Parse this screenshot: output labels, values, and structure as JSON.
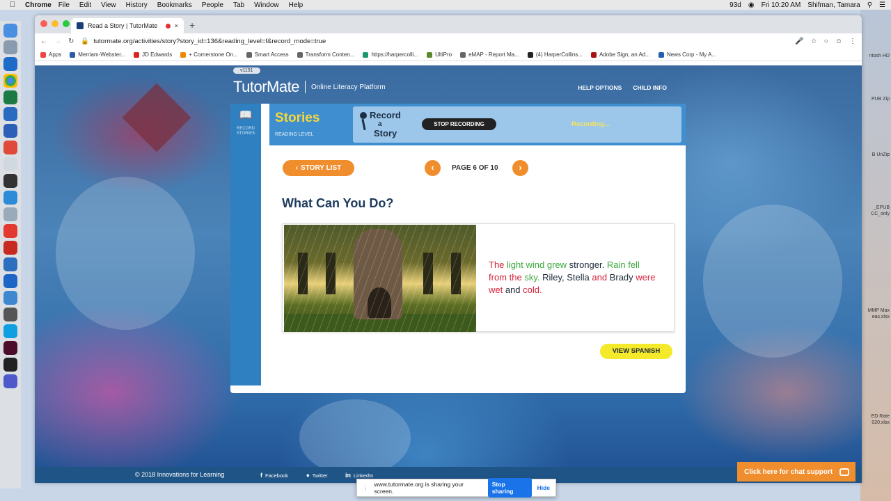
{
  "menubar": {
    "app": "Chrome",
    "items": [
      "File",
      "Edit",
      "View",
      "History",
      "Bookmarks",
      "People",
      "Tab",
      "Window",
      "Help"
    ],
    "battery": "93d",
    "clock": "Fri 10:20 AM",
    "user": "Shifman, Tamara"
  },
  "browser": {
    "tab_title": "Read a Story | TutorMate",
    "url": "tutormate.org/activities/story?story_id=136&reading_level=f&record_mode=true",
    "bookmarks": [
      "Apps",
      "Merriam-Webster...",
      "JD Edwards",
      "+ Cornerstone On...",
      "Smart Access",
      "Transform Conten...",
      "https://harpercolli...",
      "UltiPro",
      "eMAP - Report Ma...",
      "(4) HarperCollins...",
      "Adobe Sign, an Ad...",
      "News Corp - My A..."
    ]
  },
  "desktop_files": [
    "ntosh HD",
    "PUB Zip",
    "B UnZip",
    "_EPUB\nCC_only",
    "MMP Max\neas.xlsx",
    "ED Rate\n020.xlsx"
  ],
  "site": {
    "version": "v1191",
    "logo": "TutorMate",
    "tagline": "Online Literacy Platform",
    "nav": [
      "HELP OPTIONS",
      "CHILD INFO"
    ]
  },
  "panel": {
    "side_label": "RECORD STORIES",
    "section": "Stories",
    "reading_level": "READING LEVEL",
    "record_logo": [
      "Record",
      "a",
      "Story"
    ],
    "stop_button": "STOP RECORDING",
    "status": "Recording...",
    "story_list": "STORY LIST",
    "page_indicator": "PAGE 6 OF 10",
    "title": "What Can You Do?",
    "text": [
      {
        "t": "The ",
        "c": "r"
      },
      {
        "t": "light ",
        "c": "g"
      },
      {
        "t": "wind ",
        "c": "g"
      },
      {
        "t": "grew ",
        "c": "g"
      },
      {
        "t": "stronger. ",
        "c": "k"
      },
      {
        "t": "Rain ",
        "c": "g"
      },
      {
        "t": "fell ",
        "c": "g"
      },
      {
        "t": "from ",
        "c": "r"
      },
      {
        "t": "the ",
        "c": "r"
      },
      {
        "t": "sky. ",
        "c": "g"
      },
      {
        "t": "Riley, ",
        "c": "k"
      },
      {
        "t": "Stella ",
        "c": "k"
      },
      {
        "t": "and ",
        "c": "r"
      },
      {
        "t": "Brady ",
        "c": "k"
      },
      {
        "t": "were ",
        "c": "r"
      },
      {
        "t": "wet ",
        "c": "r"
      },
      {
        "t": "and ",
        "c": "k"
      },
      {
        "t": "cold.",
        "c": "r"
      }
    ],
    "spanish_button": "VIEW SPANISH"
  },
  "footer": {
    "copyright": "© 2018 Innovations for Learning",
    "social": [
      "Facebook",
      "Twitter",
      "LinkedIn"
    ],
    "chat": "Click here for chat support"
  },
  "share_bar": {
    "message": "www.tutormate.org is sharing your screen.",
    "stop": "Stop sharing",
    "hide": "Hide"
  }
}
